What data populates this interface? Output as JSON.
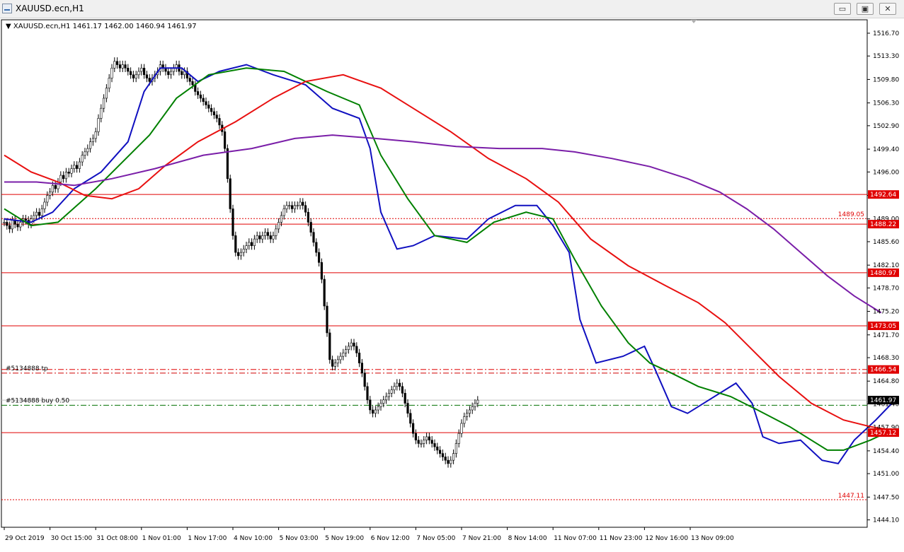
{
  "window": {
    "title": "XAUUSD.ecn,H1",
    "buttons": {
      "minimize": "▭",
      "maximize": "▣",
      "close": "✕"
    }
  },
  "chart_data": {
    "type": "line",
    "symbol_info": "XAUUSD.ecn,H1",
    "ohlc_info": "1461.17 1462.00 1460.94 1461.97",
    "ylim": [
      1443.0,
      1518.7
    ],
    "y_ticks": [
      "1516.70",
      "1513.30",
      "1509.80",
      "1506.30",
      "1502.90",
      "1499.40",
      "1496.00",
      "1492.50",
      "1489.00",
      "1485.60",
      "1482.10",
      "1478.70",
      "1475.20",
      "1471.70",
      "1468.30",
      "1464.80",
      "1461.40",
      "1457.90",
      "1454.40",
      "1451.00",
      "1447.50",
      "1444.10"
    ],
    "x_labels": [
      "29 Oct 2019",
      "30 Oct 15:00",
      "31 Oct 08:00",
      "1 Nov 01:00",
      "1 Nov 17:00",
      "4 Nov 10:00",
      "5 Nov 03:00",
      "5 Nov 19:00",
      "6 Nov 12:00",
      "7 Nov 05:00",
      "7 Nov 21:00",
      "8 Nov 14:00",
      "11 Nov 07:00",
      "11 Nov 23:00",
      "12 Nov 16:00",
      "13 Nov 09:00"
    ],
    "x_axis_note": "x values are bar indices counted from the leftmost visible bar; the x_labels tick every 17 bars starting at bar 0",
    "current_price": {
      "value": 1461.97,
      "label": "1461.97"
    },
    "horizontal_lines": [
      {
        "value": 1492.64,
        "label": "1492.64",
        "style": "solid"
      },
      {
        "value": 1489.05,
        "label": "1489.05",
        "style": "dotted"
      },
      {
        "value": 1488.22,
        "label": "1488.22",
        "style": "solid"
      },
      {
        "value": 1480.97,
        "label": "1480.97",
        "style": "solid"
      },
      {
        "value": 1473.05,
        "label": "1473.05",
        "style": "solid"
      },
      {
        "value": 1466.54,
        "label": "1466.54",
        "style": "dashdot"
      },
      {
        "value": 1457.12,
        "label": "1457.12",
        "style": "solid"
      },
      {
        "value": 1447.11,
        "label": "1447.11",
        "style": "dotted"
      }
    ],
    "order_lines": [
      {
        "value": 1466.0,
        "label": "#5134888 tp",
        "color": "#d00000"
      },
      {
        "value": 1461.2,
        "label": "#5134888 buy 0.50",
        "color": "#007000"
      }
    ],
    "colors": {
      "line_red": "#e00000",
      "ma_blue": "#1010c0",
      "ma_green": "#008000",
      "ma_red": "#e81010",
      "ma_purple": "#7a1ea8",
      "price_line": "#c0c0c0",
      "buy_line": "#008000"
    },
    "series": [
      {
        "values_from": "close",
        "color": "#1010c0",
        "points": [
          [
            0,
            1489.0
          ],
          [
            10,
            1488.5
          ],
          [
            18,
            1490.0
          ],
          [
            26,
            1493.5
          ],
          [
            36,
            1496.0
          ],
          [
            46,
            1500.5
          ],
          [
            52,
            1508.0
          ],
          [
            58,
            1511.5
          ],
          [
            66,
            1511.5
          ],
          [
            72,
            1509.5
          ],
          [
            80,
            1511.0
          ],
          [
            90,
            1512.0
          ],
          [
            100,
            1510.5
          ],
          [
            112,
            1509.0
          ],
          [
            122,
            1505.5
          ],
          [
            132,
            1504.0
          ],
          [
            136,
            1499.5
          ],
          [
            140,
            1490.0
          ],
          [
            146,
            1484.5
          ],
          [
            152,
            1485.0
          ],
          [
            160,
            1486.5
          ],
          [
            172,
            1486.0
          ],
          [
            180,
            1489.0
          ],
          [
            190,
            1491.0
          ],
          [
            198,
            1491.0
          ],
          [
            204,
            1488.0
          ],
          [
            210,
            1484.0
          ],
          [
            214,
            1474.0
          ],
          [
            220,
            1467.5
          ],
          [
            230,
            1468.5
          ],
          [
            238,
            1470.0
          ],
          [
            242,
            1466.5
          ],
          [
            248,
            1461.0
          ],
          [
            254,
            1460.0
          ],
          [
            262,
            1462.0
          ],
          [
            272,
            1464.5
          ],
          [
            278,
            1461.5
          ],
          [
            282,
            1456.5
          ],
          [
            288,
            1455.5
          ],
          [
            296,
            1456.0
          ],
          [
            304,
            1453.0
          ],
          [
            310,
            1452.5
          ],
          [
            316,
            1456.0
          ],
          [
            324,
            1459.0
          ],
          [
            330,
            1461.5
          ]
        ]
      },
      {
        "values_from": "close",
        "color": "#008000",
        "points": [
          [
            0,
            1490.5
          ],
          [
            10,
            1488.0
          ],
          [
            20,
            1488.5
          ],
          [
            34,
            1493.5
          ],
          [
            44,
            1497.5
          ],
          [
            54,
            1501.5
          ],
          [
            64,
            1507.0
          ],
          [
            76,
            1510.5
          ],
          [
            90,
            1511.5
          ],
          [
            104,
            1511.0
          ],
          [
            120,
            1508.0
          ],
          [
            132,
            1506.0
          ],
          [
            140,
            1498.5
          ],
          [
            150,
            1492.0
          ],
          [
            160,
            1486.5
          ],
          [
            172,
            1485.5
          ],
          [
            182,
            1488.5
          ],
          [
            194,
            1490.0
          ],
          [
            204,
            1489.0
          ],
          [
            212,
            1483.0
          ],
          [
            222,
            1476.0
          ],
          [
            232,
            1470.5
          ],
          [
            240,
            1467.5
          ],
          [
            248,
            1466.0
          ],
          [
            258,
            1464.0
          ],
          [
            270,
            1462.5
          ],
          [
            280,
            1460.5
          ],
          [
            292,
            1458.0
          ],
          [
            300,
            1456.0
          ],
          [
            306,
            1454.5
          ],
          [
            312,
            1454.5
          ],
          [
            322,
            1456.0
          ],
          [
            330,
            1457.5
          ]
        ]
      },
      {
        "values_from": "close",
        "color": "#e81010",
        "points": [
          [
            0,
            1498.5
          ],
          [
            10,
            1496.0
          ],
          [
            20,
            1494.5
          ],
          [
            30,
            1492.5
          ],
          [
            40,
            1492.0
          ],
          [
            50,
            1493.5
          ],
          [
            60,
            1497.0
          ],
          [
            72,
            1500.5
          ],
          [
            86,
            1503.5
          ],
          [
            100,
            1507.0
          ],
          [
            112,
            1509.5
          ],
          [
            126,
            1510.5
          ],
          [
            140,
            1508.5
          ],
          [
            152,
            1505.5
          ],
          [
            166,
            1502.0
          ],
          [
            180,
            1498.0
          ],
          [
            194,
            1495.0
          ],
          [
            206,
            1491.5
          ],
          [
            218,
            1486.0
          ],
          [
            232,
            1482.0
          ],
          [
            246,
            1479.0
          ],
          [
            258,
            1476.5
          ],
          [
            268,
            1473.5
          ],
          [
            278,
            1469.5
          ],
          [
            288,
            1465.5
          ],
          [
            300,
            1461.5
          ],
          [
            312,
            1459.0
          ],
          [
            322,
            1458.0
          ],
          [
            330,
            1457.5
          ]
        ]
      },
      {
        "values_from": "close",
        "color": "#7a1ea8",
        "points": [
          [
            0,
            1494.5
          ],
          [
            12,
            1494.5
          ],
          [
            26,
            1494.0
          ],
          [
            40,
            1495.0
          ],
          [
            56,
            1496.5
          ],
          [
            74,
            1498.5
          ],
          [
            92,
            1499.5
          ],
          [
            108,
            1501.0
          ],
          [
            122,
            1501.5
          ],
          [
            138,
            1501.0
          ],
          [
            152,
            1500.5
          ],
          [
            168,
            1499.8
          ],
          [
            184,
            1499.5
          ],
          [
            200,
            1499.5
          ],
          [
            212,
            1499.0
          ],
          [
            226,
            1498.0
          ],
          [
            240,
            1496.8
          ],
          [
            254,
            1495.0
          ],
          [
            266,
            1493.0
          ],
          [
            276,
            1490.5
          ],
          [
            286,
            1487.5
          ],
          [
            296,
            1484.0
          ],
          [
            306,
            1480.5
          ],
          [
            316,
            1477.5
          ],
          [
            326,
            1475.0
          ]
        ]
      }
    ],
    "candles_close": [
      1488.5,
      1488.0,
      1487.5,
      1488.8,
      1488.2,
      1487.8,
      1488.5,
      1489.0,
      1488.8,
      1488.2,
      1489.0,
      1489.5,
      1490.0,
      1489.5,
      1490.5,
      1491.5,
      1492.5,
      1493.0,
      1494.0,
      1493.5,
      1494.5,
      1495.5,
      1495.0,
      1496.0,
      1495.8,
      1496.5,
      1497.0,
      1496.5,
      1497.5,
      1498.5,
      1499.0,
      1499.5,
      1500.5,
      1501.0,
      1502.0,
      1504.0,
      1505.5,
      1507.0,
      1508.5,
      1510.0,
      1511.5,
      1512.5,
      1512.0,
      1511.5,
      1512.0,
      1511.5,
      1511.0,
      1510.5,
      1510.0,
      1510.5,
      1511.0,
      1511.5,
      1510.5,
      1510.0,
      1509.5,
      1510.0,
      1510.5,
      1511.0,
      1512.0,
      1511.5,
      1511.0,
      1510.5,
      1511.0,
      1511.5,
      1512.0,
      1511.0,
      1510.5,
      1511.0,
      1510.0,
      1509.5,
      1509.0,
      1508.0,
      1507.5,
      1507.0,
      1506.5,
      1506.0,
      1505.5,
      1505.0,
      1504.5,
      1504.0,
      1503.0,
      1502.0,
      1499.5,
      1495.0,
      1490.5,
      1486.5,
      1484.0,
      1483.5,
      1484.0,
      1484.5,
      1485.0,
      1485.5,
      1485.0,
      1486.0,
      1486.5,
      1486.0,
      1486.5,
      1487.0,
      1486.5,
      1486.0,
      1486.5,
      1487.5,
      1488.5,
      1489.5,
      1490.5,
      1491.0,
      1491.0,
      1490.5,
      1491.0,
      1491.0,
      1491.5,
      1491.0,
      1490.0,
      1488.5,
      1487.0,
      1485.5,
      1484.0,
      1482.5,
      1480.0,
      1476.0,
      1472.0,
      1468.0,
      1467.0,
      1467.5,
      1468.0,
      1468.5,
      1469.0,
      1469.5,
      1470.0,
      1470.5,
      1470.0,
      1469.0,
      1467.5,
      1466.0,
      1464.0,
      1462.0,
      1460.5,
      1460.0,
      1460.5,
      1461.0,
      1461.5,
      1462.0,
      1462.5,
      1463.0,
      1463.5,
      1464.0,
      1464.5,
      1464.0,
      1463.0,
      1461.5,
      1460.0,
      1458.5,
      1457.0,
      1456.0,
      1455.5,
      1455.5,
      1456.0,
      1456.5,
      1456.0,
      1455.5,
      1455.0,
      1454.5,
      1454.0,
      1453.5,
      1453.0,
      1452.5,
      1453.0,
      1454.0,
      1455.5,
      1457.0,
      1458.5,
      1459.5,
      1460.0,
      1460.5,
      1461.0,
      1461.5,
      1461.97
    ]
  }
}
